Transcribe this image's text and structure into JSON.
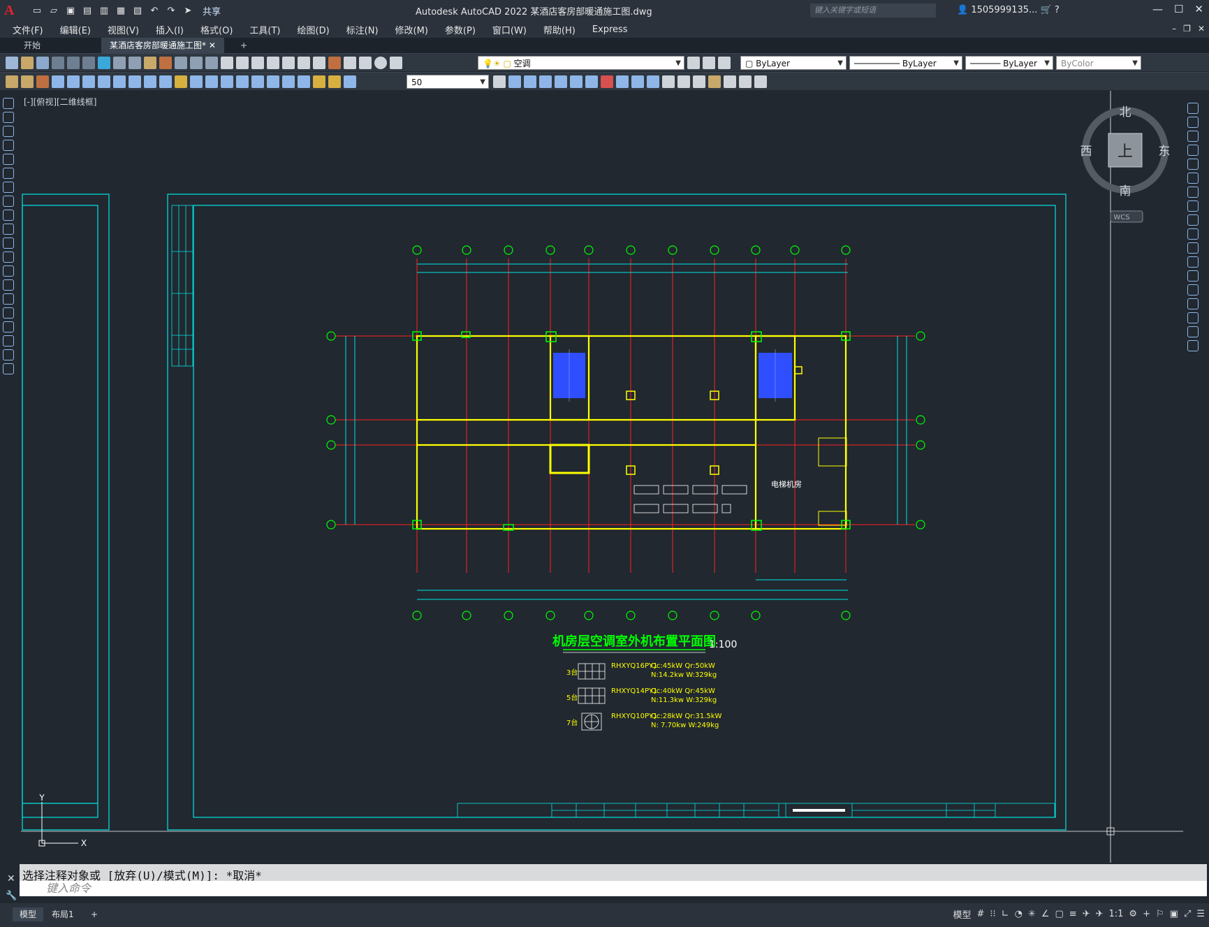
{
  "window": {
    "app_logo": "A",
    "title": "Autodesk AutoCAD 2022    某酒店客房部暖通施工图.dwg",
    "share_label": "共享",
    "search_placeholder": "键入关键字或短语",
    "user": "1505999135...",
    "controls": [
      "—",
      "☐",
      "✕"
    ]
  },
  "menu": {
    "items": [
      "文件(F)",
      "编辑(E)",
      "视图(V)",
      "插入(I)",
      "格式(O)",
      "工具(T)",
      "绘图(D)",
      "标注(N)",
      "修改(M)",
      "参数(P)",
      "窗口(W)",
      "帮助(H)",
      "Express"
    ]
  },
  "tabs": {
    "start": "开始",
    "doc": "某酒店客房部暖通施工图*",
    "add": "+"
  },
  "toolbar": {
    "layer": "空调",
    "color": "ByLayer",
    "linetype": "ByLayer",
    "lineweight": "ByLayer",
    "plotstyle": "ByColor",
    "dimscale": "50"
  },
  "viewport": {
    "label": "[-][俯视][二维线框]"
  },
  "viewcube": {
    "north": "北",
    "south": "南",
    "east": "东",
    "west": "西",
    "face": "上",
    "wcs": "WCS"
  },
  "drawing": {
    "title": "机房层空调室外机布置平面图",
    "scale": "1:100",
    "room_label": "电梯机房",
    "legend": [
      {
        "qty": "3台",
        "model": "RHXYQ16PY1",
        "line1": "Qc:45kW   Qr:50kW",
        "line2": "N:14.2kw   W:329kg"
      },
      {
        "qty": "5台",
        "model": "RHXYQ14PY1",
        "line1": "Qc:40kW   Qr:45kW",
        "line2": "N:11.3kw   W:329kg"
      },
      {
        "qty": "7台",
        "model": "RHXYQ10PY1",
        "line1": "Qc:28kW   Qr:31.5kW",
        "line2": "N: 7.70kw   W:249kg"
      }
    ]
  },
  "command": {
    "history": "选择注释对象或 [放弃(U)/模式(M)]: *取消*",
    "placeholder": "键入命令"
  },
  "status": {
    "model_tab": "模型",
    "layout_tab": "布局1",
    "add": "+",
    "model_label": "模型",
    "scale": "1:1"
  },
  "colors": {
    "background": "#212830",
    "frame": "#00e5e5",
    "wall": "#ffff00",
    "axis": "#ff2020",
    "grid_bubble": "#00ff00",
    "stairs": "#2f4fff"
  }
}
